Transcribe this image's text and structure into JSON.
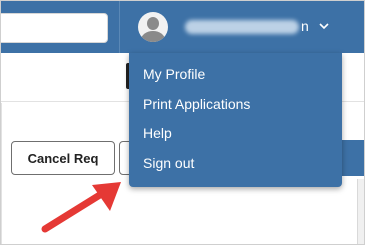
{
  "header": {
    "search": {
      "value": "",
      "placeholder": ""
    },
    "user": {
      "name_visible_suffix": "n"
    }
  },
  "user_menu": {
    "items": [
      {
        "label": "My Profile"
      },
      {
        "label": "Print Applications"
      },
      {
        "label": "Help"
      },
      {
        "label": "Sign out"
      }
    ]
  },
  "toolbar": {
    "cancel_label": "Cancel Req",
    "next_label": ""
  },
  "colors": {
    "header_bg": "#3d71a6",
    "menu_bg": "#3d71a6",
    "arrow": "#e53935"
  },
  "icons": [
    "avatar-icon",
    "chevron-down-icon",
    "red-arrow-annotation"
  ]
}
